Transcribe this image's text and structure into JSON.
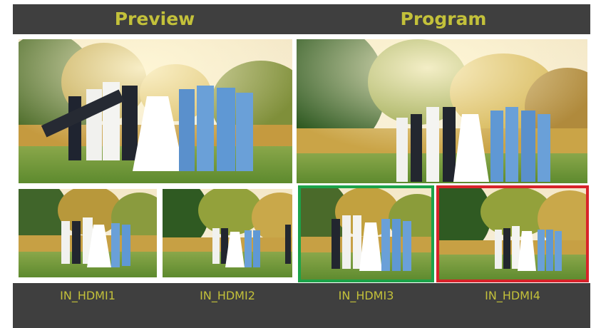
{
  "header": {
    "preview_title": "Preview",
    "program_title": "Program"
  },
  "inputs": [
    {
      "label": "IN_HDMI1"
    },
    {
      "label": "IN_HDMI2"
    },
    {
      "label": "IN_HDMI3"
    },
    {
      "label": "IN_HDMI4"
    }
  ],
  "colors": {
    "title_text": "#c3c13a",
    "bar_bg": "#3f3f3f",
    "preview_highlight": "#1ca34a",
    "program_highlight": "#d8232a"
  }
}
